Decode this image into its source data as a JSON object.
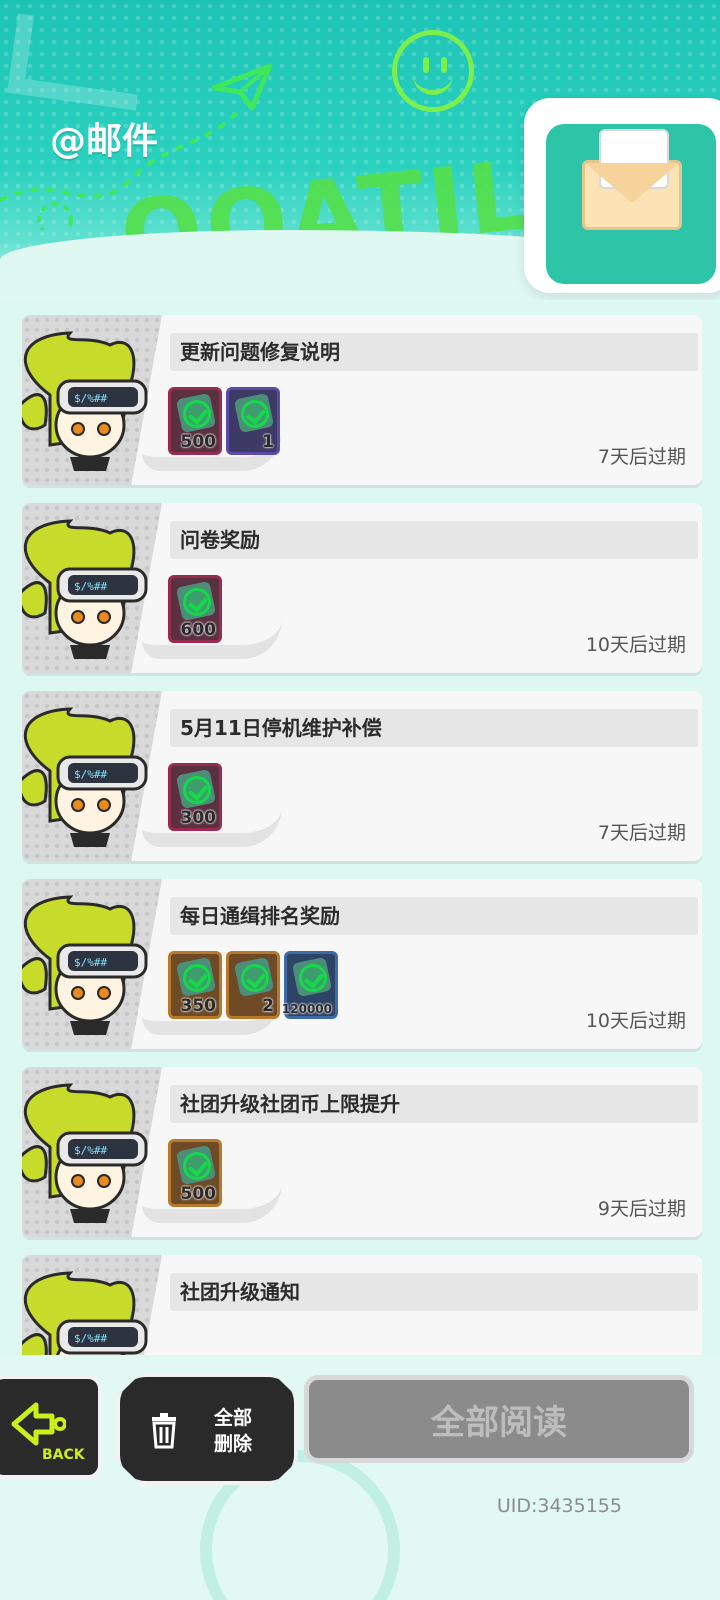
{
  "header": {
    "title": "@邮件",
    "decor_text": "OOATIL"
  },
  "mails": [
    {
      "subject": "更新问题修复说明",
      "expire": "7天后过期",
      "items": [
        {
          "icon": "green-gem-icon",
          "qty": "500",
          "frame": "red"
        },
        {
          "icon": "dark-gem-icon",
          "qty": "1",
          "frame": "purple"
        }
      ]
    },
    {
      "subject": "问卷奖励",
      "expire": "10天后过期",
      "items": [
        {
          "icon": "green-gem-icon",
          "qty": "600",
          "frame": "red"
        }
      ]
    },
    {
      "subject": "5月11日停机维护补偿",
      "expire": "7天后过期",
      "items": [
        {
          "icon": "green-gem-icon",
          "qty": "300",
          "frame": "red"
        }
      ]
    },
    {
      "subject": "每日通缉排名奖励",
      "expire": "10天后过期",
      "items": [
        {
          "icon": "gold-coin-icon",
          "qty": "350",
          "frame": "gold"
        },
        {
          "icon": "ticket-icon",
          "qty": "2",
          "frame": "gold"
        },
        {
          "icon": "cash-icon",
          "qty": "120000",
          "frame": "blue"
        }
      ]
    },
    {
      "subject": "社团升级社团币上限提升",
      "expire": "9天后过期",
      "items": [
        {
          "icon": "club-coin-icon",
          "qty": "500",
          "frame": "gold"
        }
      ]
    },
    {
      "subject": "社团升级通知",
      "expire": "",
      "items": []
    }
  ],
  "footer": {
    "back_label": "BACK",
    "delete_all_label_1": "全部",
    "delete_all_label_2": "删除",
    "read_all_label": "全部阅读",
    "uid": "UID:3435155"
  },
  "colors": {
    "header_teal": "#1dc4b6",
    "accent_green": "#54e04a",
    "check_green": "#16d84b",
    "button_dark": "#2a2a2a",
    "button_disabled": "#8b8b8b"
  }
}
